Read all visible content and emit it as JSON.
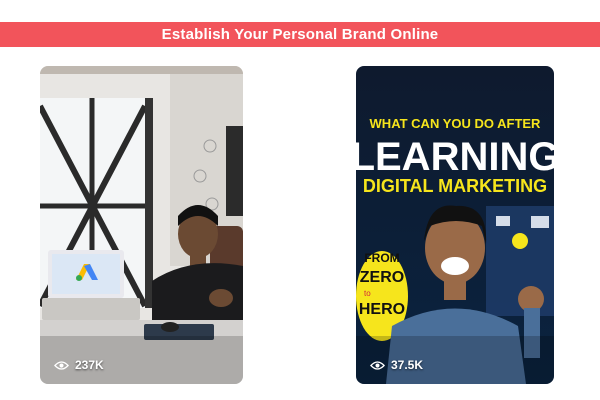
{
  "header": {
    "title": "Establish Your Personal Brand Online"
  },
  "videos": [
    {
      "views": "237K",
      "icon": "eye-icon"
    },
    {
      "views": "37.5K",
      "icon": "eye-icon",
      "thumbnail_text": {
        "line1": "WHAT CAN YOU DO AFTER",
        "line2": "LEARNING",
        "line3": "DIGITAL MARKETING",
        "badge_top": "FROM",
        "badge_mid": "ZERO",
        "badge_to": "to",
        "badge_bottom": "HERO"
      }
    }
  ],
  "colors": {
    "banner": "#f2545b",
    "yellow": "#f6e51c"
  }
}
